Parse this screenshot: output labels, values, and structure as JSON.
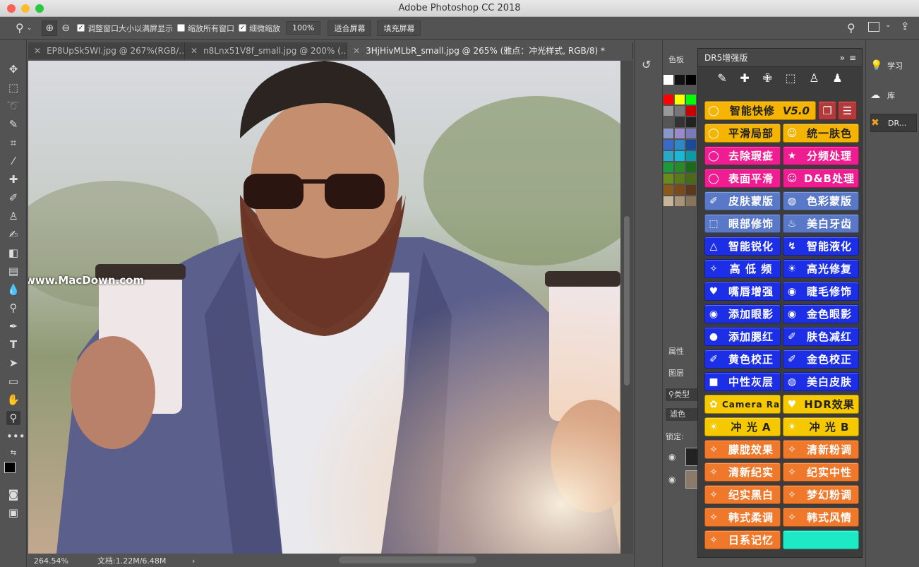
{
  "window": {
    "title": "Adobe Photoshop CC 2018"
  },
  "options": {
    "resize_windows": "调整窗口大小以满屏显示",
    "zoom_all": "缩放所有窗口",
    "scrubby_zoom": "细微缩放",
    "zoom_value": "100%",
    "fit_screen": "适合屏幕",
    "fill_screen": "填充屏幕"
  },
  "tabs": [
    {
      "label": "EP8UpSk5WI.jpg @ 267%(RGB/..."
    },
    {
      "label": "n8Lnx51V8f_small.jpg @ 200% (..."
    },
    {
      "label": "3HjHivMLbR_small.jpg @ 265% (雅点：冲光样式, RGB/8) *"
    }
  ],
  "watermark": "www.MacDown.com",
  "status": {
    "zoom": "264.54%",
    "doc": "文档:1.22M/6.48M",
    "arrow": "›"
  },
  "swatches_panel": {
    "title": "色板",
    "properties": "属性",
    "layers": "图层",
    "type_filter": "类型",
    "blend": "滤色",
    "lock": "锁定:"
  },
  "dr5": {
    "title": "DR5增强版",
    "version": "V5.0",
    "buttons": [
      {
        "label": "智能快修",
        "icon": "lasso-icon",
        "color": "#f5b400"
      },
      {
        "label": "平滑局部",
        "icon": "lasso-icon",
        "color": "#f5b400"
      },
      {
        "label": "统一肤色",
        "icon": "face-icon",
        "color": "#f5b400"
      },
      {
        "label": "去除瑕疵",
        "icon": "lasso-icon",
        "color": "#f01c92"
      },
      {
        "label": "分频处理",
        "icon": "star-icon",
        "color": "#f01c92"
      },
      {
        "label": "表面平滑",
        "icon": "lasso-icon",
        "color": "#f01c92"
      },
      {
        "label": "D&B处理",
        "icon": "face-icon",
        "color": "#f01c92"
      },
      {
        "label": "皮肤蒙版",
        "icon": "dropper-icon",
        "color": "#5a78c8"
      },
      {
        "label": "色彩蒙版",
        "icon": "mask-icon",
        "color": "#5a78c8"
      },
      {
        "label": "眼部修饰",
        "icon": "marquee-icon",
        "color": "#5a78c8"
      },
      {
        "label": "美白牙齿",
        "icon": "tooth-icon",
        "color": "#5a78c8"
      },
      {
        "label": "智能锐化",
        "icon": "triangle-icon",
        "color": "#1c2fe6"
      },
      {
        "label": "智能液化",
        "icon": "liquify-icon",
        "color": "#1c2fe6"
      },
      {
        "label": "高 低 频",
        "icon": "wand-icon",
        "color": "#1c2fe6"
      },
      {
        "label": "高光修复",
        "icon": "sun-icon",
        "color": "#1c2fe6"
      },
      {
        "label": "嘴唇增强",
        "icon": "lips-icon",
        "color": "#1c2fe6"
      },
      {
        "label": "睫毛修饰",
        "icon": "eye-icon",
        "color": "#1c2fe6"
      },
      {
        "label": "添加眼影",
        "icon": "eye-icon",
        "color": "#1c2fe6"
      },
      {
        "label": "金色眼影",
        "icon": "eye-icon",
        "color": "#1c2fe6"
      },
      {
        "label": "添加腮红",
        "icon": "blush-icon",
        "color": "#1c2fe6"
      },
      {
        "label": "肤色减红",
        "icon": "dropper-icon",
        "color": "#1c2fe6"
      },
      {
        "label": "黄色校正",
        "icon": "dropper-icon",
        "color": "#1c2fe6"
      },
      {
        "label": "金色校正",
        "icon": "dropper-icon",
        "color": "#1c2fe6"
      },
      {
        "label": "中性灰层",
        "icon": "square-icon",
        "color": "#1c2fe6"
      },
      {
        "label": "美白皮肤",
        "icon": "mask-icon",
        "color": "#1c2fe6"
      },
      {
        "label": "Camera Raw",
        "icon": "flower-icon",
        "color": "#f5c800"
      },
      {
        "label": "HDR效果",
        "icon": "heart-icon",
        "color": "#f5c800"
      },
      {
        "label": "冲 光 A",
        "icon": "sun-icon",
        "color": "#f5c800"
      },
      {
        "label": "冲 光 B",
        "icon": "sun-icon",
        "color": "#f5c800"
      },
      {
        "label": "朦胧效果",
        "icon": "wand-icon",
        "color": "#f0782a"
      },
      {
        "label": "清新粉调",
        "icon": "wand-icon",
        "color": "#f0782a"
      },
      {
        "label": "清新纪实",
        "icon": "wand-icon",
        "color": "#f0782a"
      },
      {
        "label": "纪实中性",
        "icon": "wand-icon",
        "color": "#f0782a"
      },
      {
        "label": "纪实黑白",
        "icon": "wand-icon",
        "color": "#f0782a"
      },
      {
        "label": "梦幻粉调",
        "icon": "wand-icon",
        "color": "#f0782a"
      },
      {
        "label": "韩式柔调",
        "icon": "wand-icon",
        "color": "#f0782a"
      },
      {
        "label": "韩式风情",
        "icon": "wand-icon",
        "color": "#f0782a"
      },
      {
        "label": "日系记忆",
        "icon": "wand-icon",
        "color": "#f0782a"
      },
      {
        "label": "",
        "icon": "",
        "color": "#1de9c4"
      }
    ]
  },
  "right_panel": {
    "learn": "学习",
    "library": "库",
    "dr": "DR..."
  }
}
